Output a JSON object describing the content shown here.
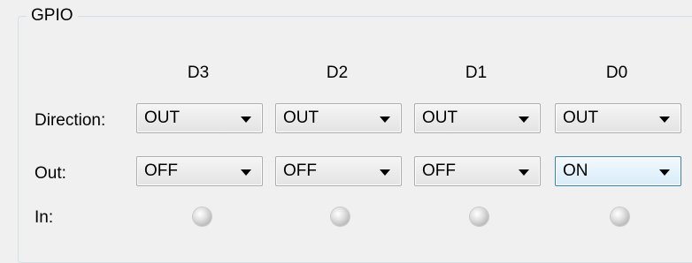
{
  "gpio": {
    "title": "GPIO",
    "columns": [
      "D3",
      "D2",
      "D1",
      "D0"
    ],
    "rows": {
      "direction": {
        "label": "Direction:",
        "values": [
          "OUT",
          "OUT",
          "OUT",
          "OUT"
        ]
      },
      "out": {
        "label": "Out:",
        "values": [
          "OFF",
          "OFF",
          "OFF",
          "ON"
        ]
      },
      "in": {
        "label": "In:",
        "states": [
          "off",
          "off",
          "off",
          "off"
        ]
      }
    }
  }
}
